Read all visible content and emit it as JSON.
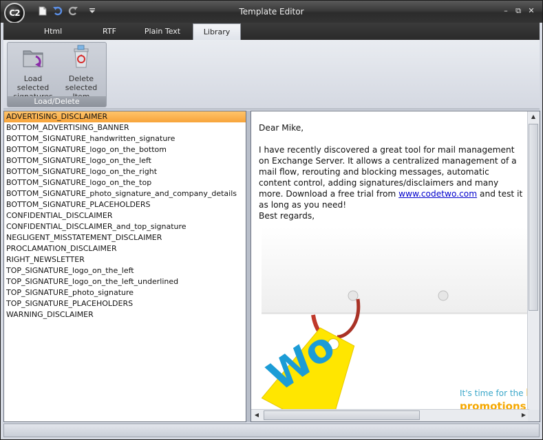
{
  "window": {
    "title": "Template Editor",
    "logo_text": "C2",
    "controls": {
      "minimize": "–",
      "restore": "⧉",
      "close": "✕"
    }
  },
  "quick_access": [
    {
      "name": "new-document-icon"
    },
    {
      "name": "undo-icon"
    },
    {
      "name": "redo-icon"
    },
    {
      "name": "customize-toolbar-icon"
    }
  ],
  "tabs": [
    {
      "label": "Html",
      "active": false
    },
    {
      "label": "RTF",
      "active": false
    },
    {
      "label": "Plain Text",
      "active": false
    },
    {
      "label": "Library",
      "active": true
    }
  ],
  "ribbon": {
    "group_label": "Load/Delete",
    "load_label_1": "Load selected",
    "load_label_2": "signatures",
    "delete_label_1": "Delete",
    "delete_label_2": "selected Item"
  },
  "library": {
    "selected_index": 0,
    "items": [
      "ADVERTISING_DISCLAIMER",
      "BOTTOM_ADVERTISING_BANNER",
      "BOTTOM_SIGNATURE_handwritten_signature",
      "BOTTOM_SIGNATURE_logo_on_the_bottom",
      "BOTTOM_SIGNATURE_logo_on_the_left",
      "BOTTOM_SIGNATURE_logo_on_the_right",
      "BOTTOM_SIGNATURE_logo_on_the_top",
      "BOTTOM_SIGNATURE_photo_signature_and_company_details",
      "BOTTOM_SIGNATURE_PLACEHOLDERS",
      "CONFIDENTIAL_DISCLAIMER",
      "CONFIDENTIAL_DISCLAIMER_and_top_signature",
      "NEGLIGENT_MISSTATEMENT_DISCLAIMER",
      "PROCLAMATION_DISCLAIMER",
      "RIGHT_NEWSLETTER",
      "TOP_SIGNATURE_logo_on_the_left",
      "TOP_SIGNATURE_logo_on_the_left_underlined",
      "TOP_SIGNATURE_photo_signature",
      "TOP_SIGNATURE_PLACEHOLDERS",
      "WARNING_DISCLAIMER"
    ]
  },
  "preview": {
    "greeting": "Dear Mike,",
    "body_before_link": "I have recently discovered a great tool for mail management on Exchange Server. It allows a centralized management of a mail flow, rerouting and blocking messages, automatic content control, adding signatures/disclaimers and many more. Download a free trial from ",
    "link_text": "www.codetwo.com",
    "body_after_link": " and test it as long as you need!",
    "closing": "Best regards,",
    "banner_tag_text": "Wo",
    "promo_line_1": "It's time for the ",
    "promo_line_1_bold": "b",
    "promo_line_2": "promotions"
  },
  "colors": {
    "selection": "#f7a43a",
    "link": "#0000cc",
    "promo_blue": "#3aa7c9",
    "promo_orange": "#f5a800",
    "tag_yellow": "#ffe600"
  }
}
